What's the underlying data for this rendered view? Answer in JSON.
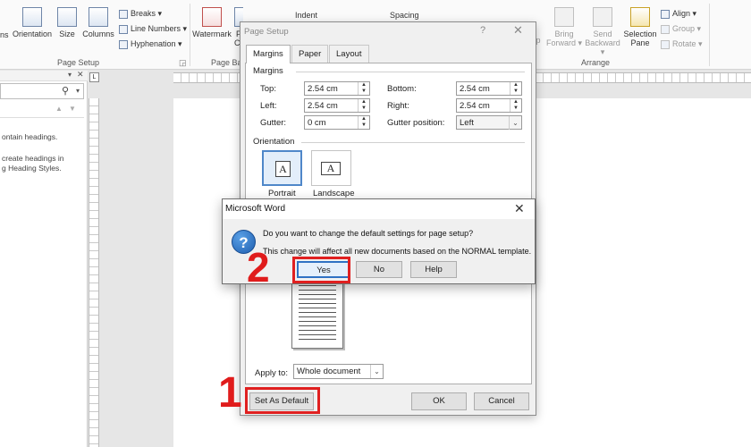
{
  "ribbon": {
    "page_setup": {
      "orientation_partial": "ns",
      "orientation": "Orientation",
      "size": "Size",
      "columns": "Columns",
      "breaks": "Breaks",
      "line_numbers": "Line Numbers",
      "hyphenation": "Hyphenation",
      "group": "Page Setup"
    },
    "page_background": {
      "watermark": "Watermark",
      "page_partial": "P",
      "color_partial": "Co",
      "group_partial": "Page Back"
    },
    "paragraph": {
      "indent": "Indent",
      "spacing": "Spacing"
    },
    "arrange": {
      "wrap_partial": "p",
      "bring_forward": [
        "Bring",
        "Forward"
      ],
      "send_backward": [
        "Send",
        "Backward"
      ],
      "selection_pane": [
        "Selection",
        "Pane"
      ],
      "align": "Align",
      "group": "Group",
      "rotate": "Rotate",
      "group_label": "Arrange"
    }
  },
  "nav_pane": {
    "lines": [
      "ontain headings.",
      "create headings in",
      "g Heading Styles."
    ]
  },
  "ruler": {
    "tab_selector": "L"
  },
  "page_setup_dialog": {
    "title": "Page Setup",
    "help": "?",
    "close": "✕",
    "tabs": [
      "Margins",
      "Paper",
      "Layout"
    ],
    "margins_heading": "Margins",
    "top_label": "Top:",
    "top_value": "2.54 cm",
    "bottom_label": "Bottom:",
    "bottom_value": "2.54 cm",
    "left_label": "Left:",
    "left_value": "2.54 cm",
    "right_label": "Right:",
    "right_value": "2.54 cm",
    "gutter_label": "Gutter:",
    "gutter_value": "0 cm",
    "gutter_position_label": "Gutter position:",
    "gutter_position_value": "Left",
    "orientation_heading": "Orientation",
    "portrait": "Portrait",
    "landscape": "Landscape",
    "apply_to_label": "Apply to:",
    "apply_to_value": "Whole document",
    "set_as_default": "Set As Default",
    "ok": "OK",
    "cancel": "Cancel"
  },
  "word_message": {
    "title": "Microsoft Word",
    "close": "✕",
    "icon": "?",
    "question": "Do you want to change the default settings for page setup?",
    "detail": "This change will affect all new documents based on the NORMAL template.",
    "yes": "Yes",
    "no": "No",
    "help": "Help"
  },
  "annotations": {
    "step1": "1",
    "step2": "2",
    "color": "#e02020"
  }
}
